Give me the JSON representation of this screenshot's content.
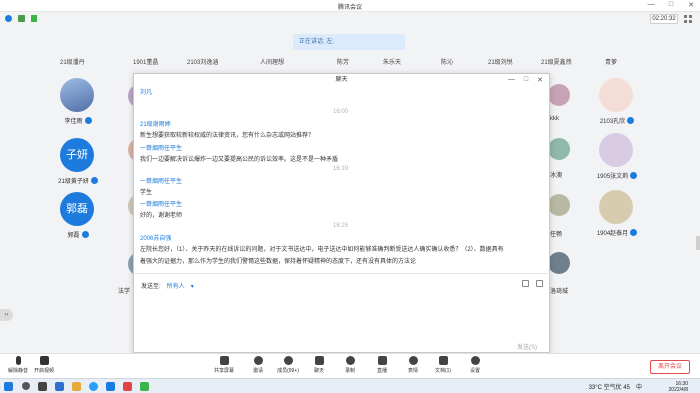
{
  "window": {
    "title": "腾讯会议",
    "controls": [
      "—",
      "□",
      "✕"
    ]
  },
  "header": {
    "timer": "02:20:32",
    "speaking": "正在讲话: 左;"
  },
  "top_names": [
    "21级潘丹",
    "1901董晶",
    "2103刘逸涵",
    "人间理想",
    "陈芳",
    "朱乐天",
    "陈沁",
    "21级刘悦",
    "21级夏鑫然",
    "青萝"
  ],
  "tiles": [
    {
      "id": "t1",
      "name": "李佳雨",
      "initials": "",
      "bg": "#6f90bf"
    },
    {
      "id": "t2",
      "name": "21级黄子妍",
      "initials": "子妍",
      "bg": "#1c7bdd"
    },
    {
      "id": "t3",
      "name": "郭磊",
      "initials": "郭磊",
      "bg": "#1c7bdd"
    },
    {
      "id": "t4",
      "name": "2103孔欣",
      "initials": "",
      "bg": "#e9c9c1"
    },
    {
      "id": "t5",
      "name": "1905张文莉",
      "initials": "",
      "bg": "#c7b7d8"
    },
    {
      "id": "t6",
      "name": "1904赵泰月",
      "initials": "",
      "bg": "#d7c9a8"
    }
  ],
  "partial_names": [
    "kkk",
    "冰澳",
    "任畅",
    "法学",
    "洛琦城"
  ],
  "chat": {
    "title": "聊天",
    "controls": [
      "—",
      "□",
      "✕"
    ],
    "send_to_label": "发送至:",
    "send_to_value": "所有人",
    "send_button": "发送(S)",
    "messages": [
      {
        "kind": "sender",
        "text": "刘凡"
      },
      {
        "kind": "time",
        "text": "16:00"
      },
      {
        "kind": "sender",
        "text": "21级谢雨婷"
      },
      {
        "kind": "text",
        "text": "新生想要获取较新较权威的法律资讯，您有什么杂志或网站推荐？"
      },
      {
        "kind": "sender",
        "text": "一蓑烟雨任平生"
      },
      {
        "kind": "text",
        "text": "我们一边要解决诉讼爆炸一边又要提高公民的诉讼效率。这是不是一种矛盾"
      },
      {
        "kind": "time",
        "text": "16:19"
      },
      {
        "kind": "sender",
        "text": "一蓑烟雨任平生"
      },
      {
        "kind": "text",
        "text": "学生"
      },
      {
        "kind": "sender",
        "text": "一蓑烟雨任平生"
      },
      {
        "kind": "text",
        "text": "好的，谢谢老师"
      },
      {
        "kind": "time",
        "text": "16:25"
      },
      {
        "kind": "sender",
        "text": "2006苏自强"
      },
      {
        "kind": "text",
        "text": "左院长您好，（1）、关于昨天的在线诉讼的问题，对于文书送达中，电子送达中如何能够准确判断受送达人确实确认收悉？（2）、数据具有"
      },
      {
        "kind": "text",
        "text": "着强大的证据力，那么作为学生的我们警惕这些数据，保持着怀疑精神的态度下，还有没有具体的方法论"
      }
    ]
  },
  "toolbar": {
    "left": [
      {
        "id": "mute",
        "label": "解除静音"
      },
      {
        "id": "video",
        "label": "开启视频"
      }
    ],
    "center": [
      {
        "id": "share",
        "label": "共享屏幕"
      },
      {
        "id": "invite",
        "label": "邀请"
      },
      {
        "id": "members",
        "label": "成员(99+)"
      },
      {
        "id": "chat",
        "label": "聊天"
      },
      {
        "id": "record",
        "label": "录制"
      },
      {
        "id": "live",
        "label": "直播"
      },
      {
        "id": "emoji",
        "label": "表情"
      },
      {
        "id": "docs",
        "label": "文档(1)"
      },
      {
        "id": "settings",
        "label": "设置"
      }
    ],
    "leave": "离开会议"
  },
  "taskbar": {
    "weather": "33°C 空气优 45",
    "lang": "中",
    "time": "16:30",
    "date": "2022/4/8"
  }
}
